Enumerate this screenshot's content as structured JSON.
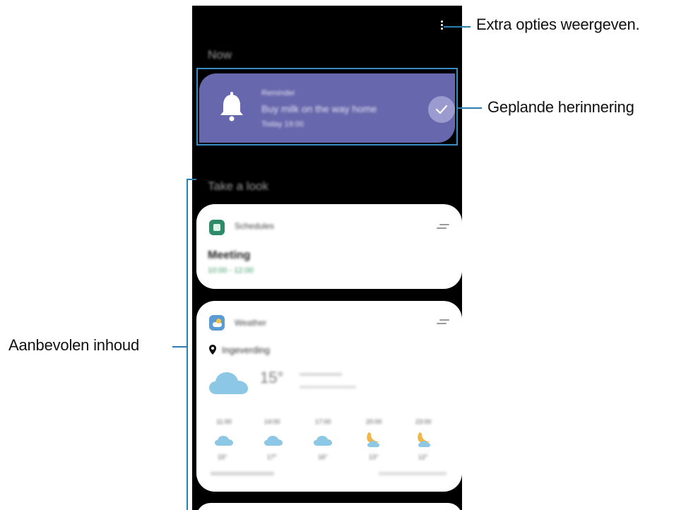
{
  "callouts": {
    "more_options": "Extra opties weergeven.",
    "reminder": "Geplande herinnering",
    "recommended": "Aanbevolen inhoud"
  },
  "phone": {
    "now_title": "Now",
    "reminder": {
      "app": "Reminder",
      "text": "Buy milk on the way home",
      "time": "Today 19:00",
      "icon": "bell-icon"
    },
    "take_a_look_title": "Take a look",
    "schedule_card": {
      "app": "Schedules",
      "event": "Meeting",
      "time": "10:00 - 12:00"
    },
    "weather_card": {
      "app": "Weather",
      "location": "Ingeverding",
      "temperature": "15°",
      "hourly": [
        {
          "time": "11:00",
          "icon": "cloud-icon",
          "temp": "15°"
        },
        {
          "time": "14:00",
          "icon": "cloud-icon",
          "temp": "17°"
        },
        {
          "time": "17:00",
          "icon": "cloud-icon",
          "temp": "16°"
        },
        {
          "time": "20:00",
          "icon": "moon-icon",
          "temp": "13°"
        },
        {
          "time": "23:00",
          "icon": "moon-icon",
          "temp": "12°"
        }
      ]
    }
  },
  "colors": {
    "reminder_card": "#6767ad",
    "callout_line": "#2a7fb0",
    "schedule_icon": "#2e8b6a",
    "weather_cloud": "#8cc7e6",
    "weather_moon": "#f1b64a"
  }
}
